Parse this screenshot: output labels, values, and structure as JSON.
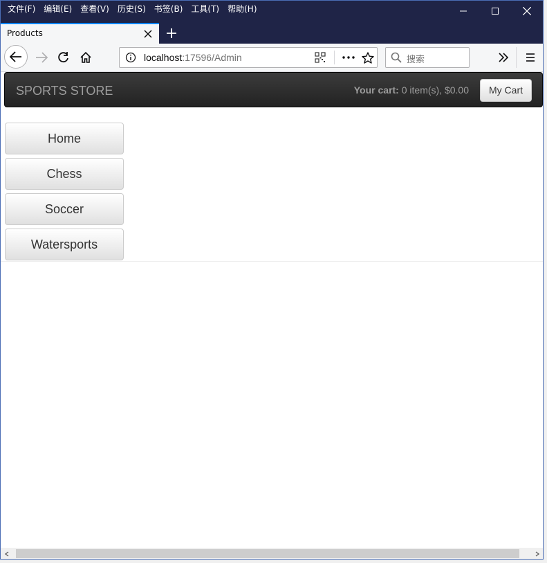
{
  "menubar": {
    "items": [
      "文件(F)",
      "编辑(E)",
      "查看(V)",
      "历史(S)",
      "书签(B)",
      "工具(T)",
      "帮助(H)"
    ]
  },
  "tab": {
    "title": "Products"
  },
  "urlbar": {
    "host": "localhost",
    "rest": ":17596/Admin"
  },
  "search": {
    "placeholder": "搜索"
  },
  "site": {
    "brand": "SPORTS STORE",
    "cart_label": "Your cart:",
    "cart_summary": "0 item(s), $0.00",
    "mycart_label": "My Cart",
    "categories": [
      "Home",
      "Chess",
      "Soccer",
      "Watersports"
    ]
  },
  "colors": {
    "titlebar": "#1f2447",
    "tab_accent": "#0a84ff",
    "navbar_dark": "#222222"
  }
}
